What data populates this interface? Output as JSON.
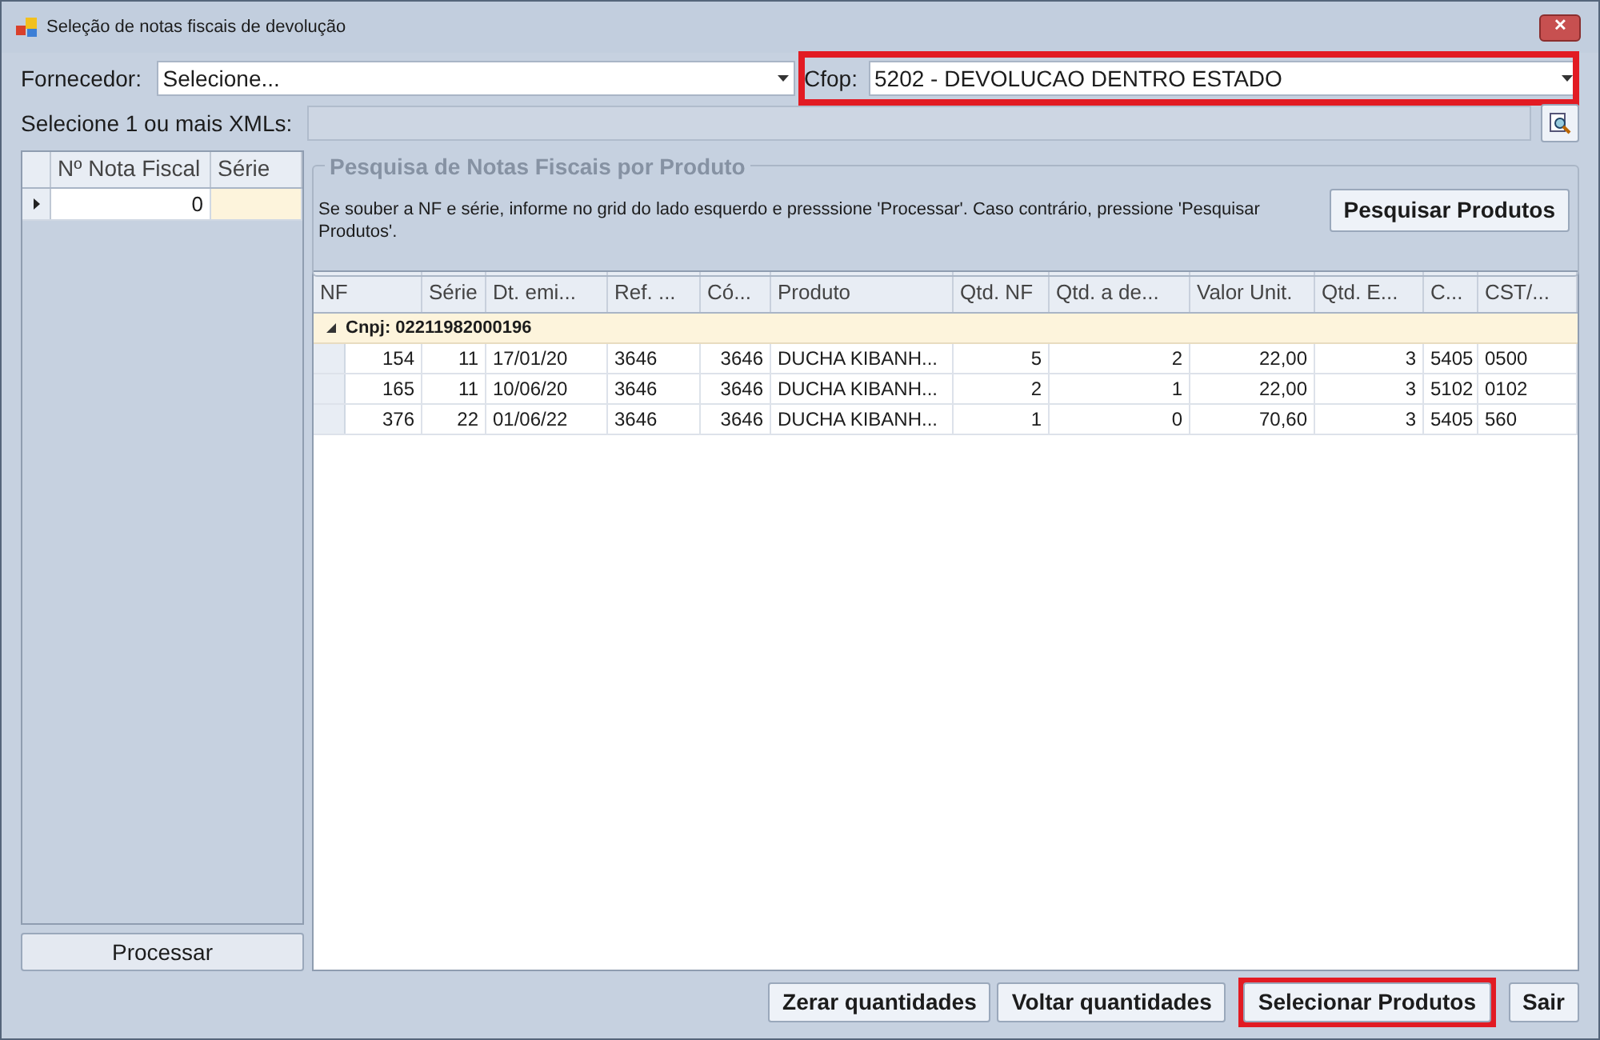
{
  "window": {
    "title": "Seleção de notas fiscais de devolução",
    "close": "✕"
  },
  "fornecedor": {
    "label": "Fornecedor:",
    "value": "Selecione..."
  },
  "cfop": {
    "label": "Cfop:",
    "value": "5202 - DEVOLUCAO DENTRO ESTADO",
    "highlighted": true
  },
  "xmls": {
    "label": "Selecione 1 ou mais XMLs:"
  },
  "left_grid": {
    "columns": [
      "Nº Nota Fiscal",
      "Série"
    ],
    "rows": [
      {
        "cells": [
          "0",
          ""
        ],
        "current": true
      }
    ]
  },
  "processar_button": "Processar",
  "group": {
    "title": "Pesquisa de Notas Fiscais por Produto",
    "hint": "Se souber a NF e série, informe no grid do lado esquerdo e presssione 'Processar'. Caso contrário, pressione 'Pesquisar Produtos'.",
    "search_button": "Pesquisar Produtos"
  },
  "table": {
    "columns": [
      "NF",
      "Série",
      "Dt. emi...",
      "Ref. ...",
      "Có...",
      "Produto",
      "Qtd. NF",
      "Qtd. a de...",
      "Valor Unit.",
      "Qtd. E...",
      "C...",
      "CST/..."
    ],
    "group_row": {
      "label": "Cnpj: 02211982000196",
      "expanded": true
    },
    "rows": [
      [
        "154",
        "11",
        "17/01/20",
        "3646",
        "3646",
        "DUCHA KIBANH...",
        "5",
        "2",
        "22,00",
        "3",
        "5405",
        "0500"
      ],
      [
        "165",
        "11",
        "10/06/20",
        "3646",
        "3646",
        "DUCHA KIBANH...",
        "2",
        "1",
        "22,00",
        "3",
        "5102",
        "0102"
      ],
      [
        "376",
        "22",
        "01/06/22",
        "3646",
        "3646",
        "DUCHA KIBANH...",
        "1",
        "0",
        "70,60",
        "3",
        "5405",
        "560"
      ]
    ]
  },
  "buttons": [
    {
      "label": "Zerar quantidades",
      "highlighted": false
    },
    {
      "label": "Voltar quantidades",
      "highlighted": false
    },
    {
      "label": "Selecionar Produtos",
      "highlighted": true
    },
    {
      "label": "Sair",
      "highlighted": false
    }
  ]
}
